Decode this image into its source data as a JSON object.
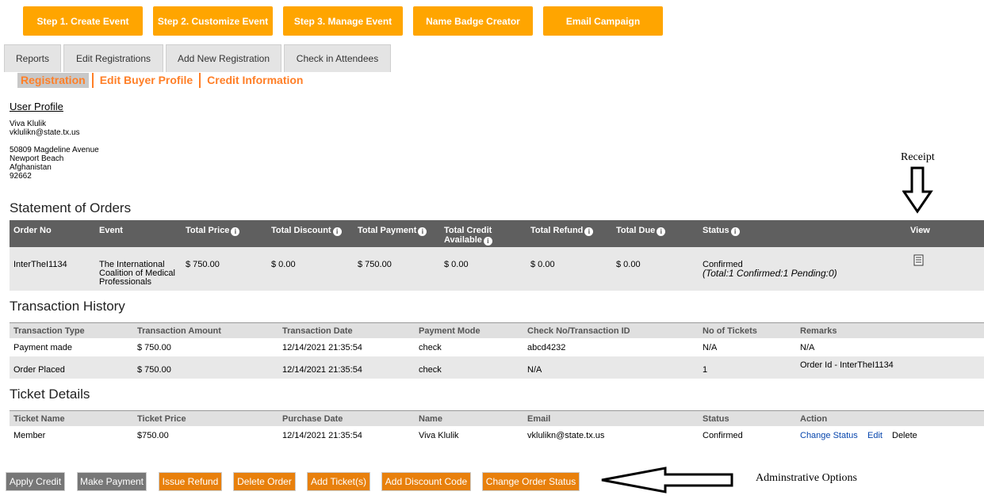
{
  "top_nav": {
    "step1": "Step 1. Create Event",
    "step2": "Step 2. Customize Event",
    "step3": "Step 3. Manage Event",
    "badge": "Name Badge Creator",
    "email": "Email Campaign"
  },
  "tabs": {
    "reports": "Reports",
    "edit_registrations": "Edit Registrations",
    "add_new": "Add New Registration",
    "check_in": "Check in Attendees"
  },
  "subtabs": {
    "registration": "Registration",
    "edit_buyer": "Edit Buyer Profile",
    "credit": "Credit Information"
  },
  "profile": {
    "title": "User Profile",
    "name": "Viva Klulik",
    "email": "vklulikn@state.tx.us",
    "street": "50809 Magdeline Avenue",
    "city": "Newport Beach",
    "country": "Afghanistan",
    "zip": "92662"
  },
  "annotations": {
    "receipt": "Receipt",
    "admin": "Adminstrative Options"
  },
  "statement": {
    "title": "Statement of Orders",
    "headers": {
      "order_no": "Order No",
      "event": "Event",
      "total_price": "Total Price",
      "total_discount": "Total Discount",
      "total_payment": "Total Payment",
      "credit_line1": "Total Credit",
      "credit_line2": "Available",
      "total_refund": "Total Refund",
      "total_due": "Total Due",
      "status": "Status",
      "view": "View"
    },
    "row": {
      "order_no": "InterTheI1134",
      "event_l1": "The International",
      "event_l2": "Coalition of Medical",
      "event_l3": "Professionals",
      "total_price": "$ 750.00",
      "total_discount": "$ 0.00",
      "total_payment": "$ 750.00",
      "credit": "$ 0.00",
      "refund": "$ 0.00",
      "due": "$ 0.00",
      "status": "Confirmed",
      "status_detail": "(Total:1 Confirmed:1 Pending:0)"
    }
  },
  "transactions": {
    "title": "Transaction History",
    "headers": [
      "Transaction Type",
      "Transaction Amount",
      "Transaction Date",
      "Payment Mode",
      "Check No/Transaction ID",
      "No of Tickets",
      "Remarks"
    ],
    "rows": [
      [
        "Payment made",
        "$ 750.00",
        "12/14/2021 21:35:54",
        "check",
        "abcd4232",
        "N/A",
        "N/A"
      ],
      [
        "Order Placed",
        "$ 750.00",
        "12/14/2021 21:35:54",
        "check",
        "N/A",
        "1",
        "Order Id - InterTheI1134"
      ]
    ]
  },
  "tickets": {
    "title": "Ticket Details",
    "headers": [
      "Ticket Name",
      "Ticket Price",
      "Purchase Date",
      "Name",
      "Email",
      "Status",
      "Action"
    ],
    "row": [
      "Member",
      "$750.00",
      "12/14/2021 21:35:54",
      "Viva Klulik",
      "vklulikn@state.tx.us",
      "Confirmed"
    ],
    "actions": {
      "change_status": "Change Status",
      "edit": "Edit",
      "delete": "Delete"
    }
  },
  "actions": {
    "apply_credit": "Apply Credit",
    "make_payment": "Make Payment",
    "issue_refund": "Issue Refund",
    "delete_order": "Delete Order",
    "add_tickets": "Add Ticket(s)",
    "add_discount": "Add Discount Code",
    "change_order_status": "Change Order Status"
  },
  "colors": {
    "accent": "#ffa500",
    "action_orange": "#e8800c",
    "action_grey": "#777777",
    "header_dark": "#5f5f5f"
  }
}
